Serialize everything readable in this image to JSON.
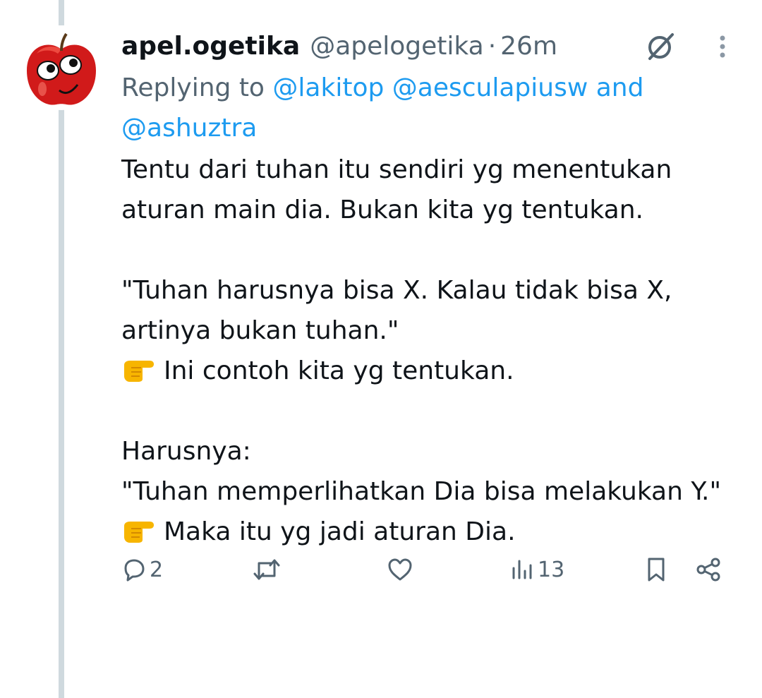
{
  "tweet": {
    "display_name": "apel.ogetika",
    "handle": "@apelogetika",
    "separator": "·",
    "time": "26m",
    "replying_prefix": "Replying to",
    "mentions": [
      "@lakitop",
      "@aesculapiusw"
    ],
    "mention_joiner": "and",
    "mention_last": "@ashuztra",
    "lines": {
      "l1": "Tentu dari tuhan itu sendiri yg menentukan",
      "l2": "aturan main dia. Bukan kita yg tentukan.",
      "l3": "\"Tuhan harusnya bisa X. Kalau tidak bisa X,",
      "l4": "artinya bukan tuhan.\"",
      "l5": "Ini contoh kita yg tentukan.",
      "l6": "Harusnya:",
      "l7": "\"Tuhan memperlihatkan Dia bisa melakukan Y.\"",
      "l8": "Maka itu yg jadi aturan Dia."
    }
  },
  "actions": {
    "reply_count": "2",
    "retweet_count": "",
    "like_count": "",
    "views_count": "13"
  },
  "icons": {
    "avatar": "red-apple-face-avatar",
    "grok": "slashed-circle-icon",
    "more": "vertical-dots-icon",
    "pointer": "backhand-index-pointing-right-emoji",
    "reply": "speech-bubble-icon",
    "retweet": "retweet-arrows-icon",
    "like": "heart-icon",
    "views": "bar-chart-icon",
    "bookmark": "bookmark-icon",
    "share": "share-nodes-icon"
  },
  "colors": {
    "link": "#1d9bf0",
    "secondary_text": "#536471",
    "thread_line": "#cfd9de"
  }
}
